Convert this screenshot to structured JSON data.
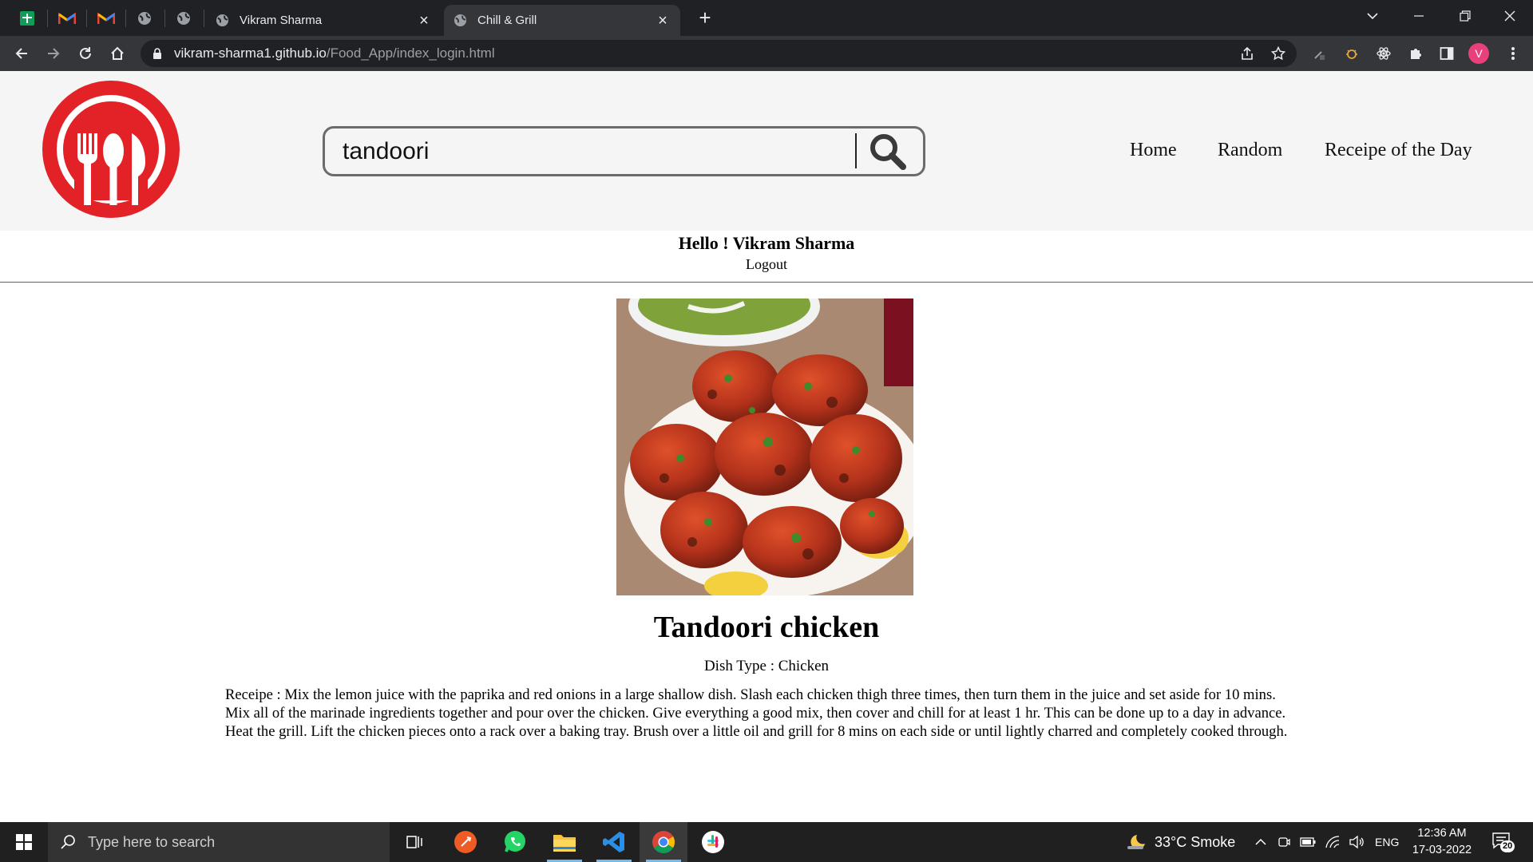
{
  "browser": {
    "tabs": [
      {
        "title": "Vikram Sharma",
        "active": false
      },
      {
        "title": "Chill & Grill",
        "active": true
      }
    ],
    "new_tab_label": "+",
    "close_glyph": "×",
    "url_domain": "vikram-sharma1.github.io",
    "url_path": "/Food_App/index_login.html",
    "profile_initial": "V"
  },
  "site": {
    "search_value": "tandoori",
    "nav": [
      "Home",
      "Random",
      "Receipe of the Day"
    ],
    "greeting": "Hello ! Vikram Sharma",
    "logout": "Logout",
    "brand_color": "#e32227"
  },
  "dish": {
    "title": "Tandoori chicken",
    "type_line": "Dish Type : Chicken",
    "recipe": "Receipe : Mix the lemon juice with the paprika and red onions in a large shallow dish. Slash each chicken thigh three times, then turn them in the juice and set aside for 10 mins. Mix all of the marinade ingredients together and pour over the chicken. Give everything a good mix, then cover and chill for at least 1 hr. This can be done up to a day in advance. Heat the grill. Lift the chicken pieces onto a rack over a baking tray. Brush over a little oil and grill for 8 mins on each side or until lightly charred and completely cooked through."
  },
  "taskbar": {
    "search_placeholder": "Type here to search",
    "weather": "33°C  Smoke",
    "language": "ENG",
    "time": "12:36 AM",
    "date": "17-03-2022",
    "notification_count": "20"
  }
}
